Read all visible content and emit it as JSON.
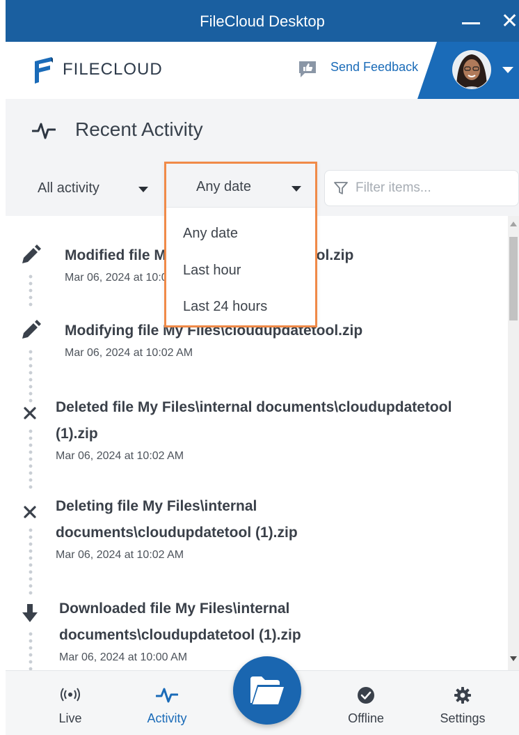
{
  "window": {
    "title": "FileCloud Desktop",
    "minimize_icon": "minimize-icon",
    "close_icon": "close-icon"
  },
  "header": {
    "logo_text": "FILECLOUD",
    "feedback_label": "Send Feedback",
    "feedback_icon": "thumbs-up-chat-icon",
    "accent_color": "#1a6bb8"
  },
  "section": {
    "title": "Recent Activity",
    "icon": "activity-pulse-icon"
  },
  "filters": {
    "activity_label": "All activity",
    "date_label": "Any date",
    "filter_placeholder": "Filter items...",
    "date_options": [
      "Any date",
      "Last hour",
      "Last 24 hours"
    ]
  },
  "activities": [
    {
      "icon": "pencil-icon",
      "lines": [
        "Modified file My Files\\cloudupdatetool.zip"
      ],
      "time": "Mar 06, 2024 at 10:02 AM"
    },
    {
      "icon": "pencil-icon",
      "lines": [
        "Modifying file My Files\\cloudupdatetool.zip"
      ],
      "time": "Mar 06, 2024 at 10:02 AM"
    },
    {
      "icon": "x-icon",
      "lines": [
        "Deleted file My Files\\internal documents\\cloudupdatetool",
        "(1).zip"
      ],
      "time": "Mar 06, 2024 at 10:02 AM"
    },
    {
      "icon": "x-icon",
      "lines": [
        "Deleting file My Files\\internal",
        "documents\\cloudupdatetool (1).zip"
      ],
      "time": "Mar 06, 2024 at 10:02 AM"
    },
    {
      "icon": "download-arrow-icon",
      "lines": [
        "Downloaded file My Files\\internal",
        "documents\\cloudupdatetool (1).zip"
      ],
      "time": "Mar 06, 2024 at 10:00 AM"
    }
  ],
  "nav": {
    "items": [
      {
        "label": "Live",
        "icon": "broadcast-icon"
      },
      {
        "label": "Activity",
        "icon": "activity-pulse-icon"
      },
      {
        "label": "Offline",
        "icon": "check-circle-icon"
      },
      {
        "label": "Settings",
        "icon": "gear-icon"
      }
    ],
    "fab_icon": "open-folder-icon",
    "active": "Activity"
  }
}
